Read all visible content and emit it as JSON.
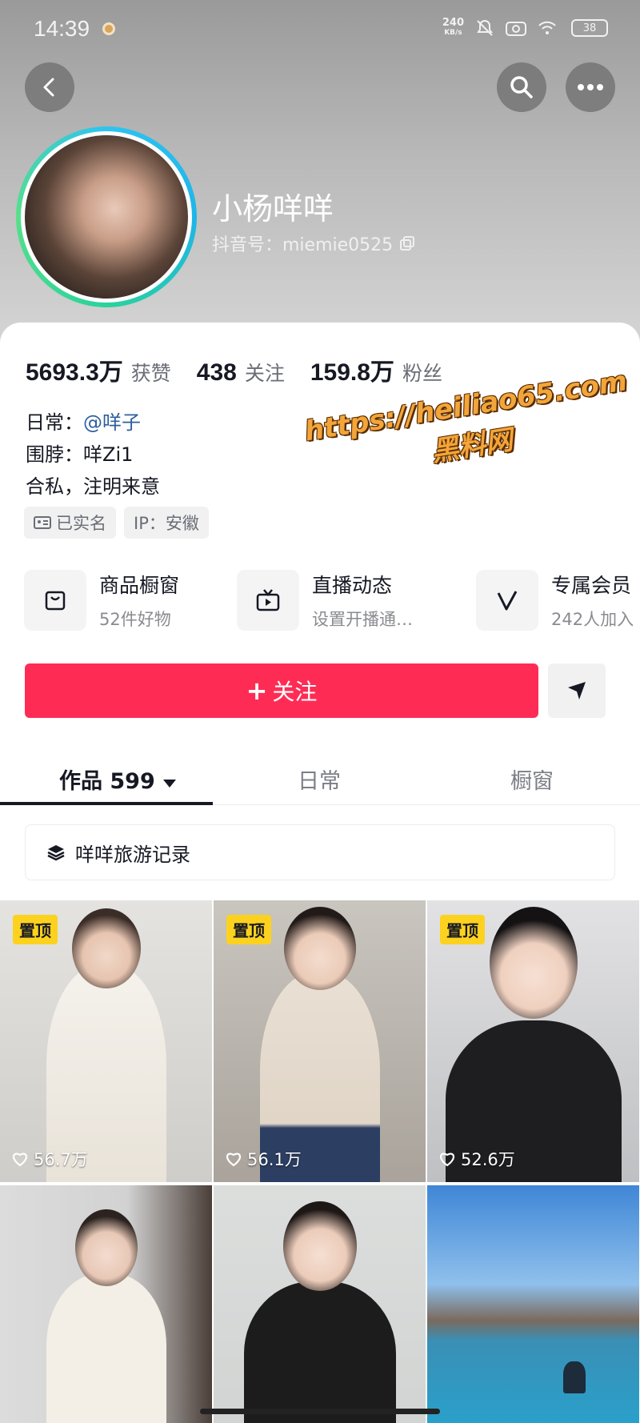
{
  "status_bar": {
    "time": "14:39",
    "net_speed_value": "240",
    "net_speed_unit": "KB/s",
    "battery": "38"
  },
  "profile": {
    "nickname": "小杨咩咩",
    "douyin_id": "抖音号：miemie0525"
  },
  "stats": [
    {
      "value": "5693.3万",
      "label": "获赞"
    },
    {
      "value": "438",
      "label": "关注"
    },
    {
      "value": "159.8万",
      "label": "粉丝"
    }
  ],
  "bio": {
    "line1_prefix": "日常：",
    "line1_mention": "@咩子",
    "line2": "围脖：咩Zi1",
    "line3": "合私，注明来意"
  },
  "tags": {
    "verified": "已实名",
    "ip": "IP：安徽"
  },
  "watermark": {
    "url": "https://heiliao65.com",
    "name": "黑料网"
  },
  "services": [
    {
      "title": "商品橱窗",
      "subtitle": "52件好物",
      "icon": "bag-icon"
    },
    {
      "title": "直播动态",
      "subtitle": "设置开播通…",
      "icon": "tv-icon"
    },
    {
      "title": "专属会员",
      "subtitle": "242人加入",
      "icon": "v-badge-icon"
    }
  ],
  "actions": {
    "follow_label": "关注",
    "follow_plus": "+"
  },
  "tabs": [
    {
      "label": "作品 599",
      "active": true
    },
    {
      "label": "日常",
      "active": false
    },
    {
      "label": "橱窗",
      "active": false
    }
  ],
  "collection": {
    "label": "咩咩旅游记录"
  },
  "videos": [
    {
      "pinned": true,
      "pin_label": "置顶",
      "likes": "56.7万"
    },
    {
      "pinned": true,
      "pin_label": "置顶",
      "likes": "56.1万"
    },
    {
      "pinned": true,
      "pin_label": "置顶",
      "likes": "52.6万"
    },
    {
      "pinned": false,
      "pin_label": "",
      "likes": ""
    },
    {
      "pinned": false,
      "pin_label": "",
      "likes": ""
    },
    {
      "pinned": false,
      "pin_label": "",
      "likes": ""
    }
  ],
  "colors": {
    "accent": "#fe2c55",
    "pin": "#fcd21e",
    "mention": "#2d5f9c"
  }
}
